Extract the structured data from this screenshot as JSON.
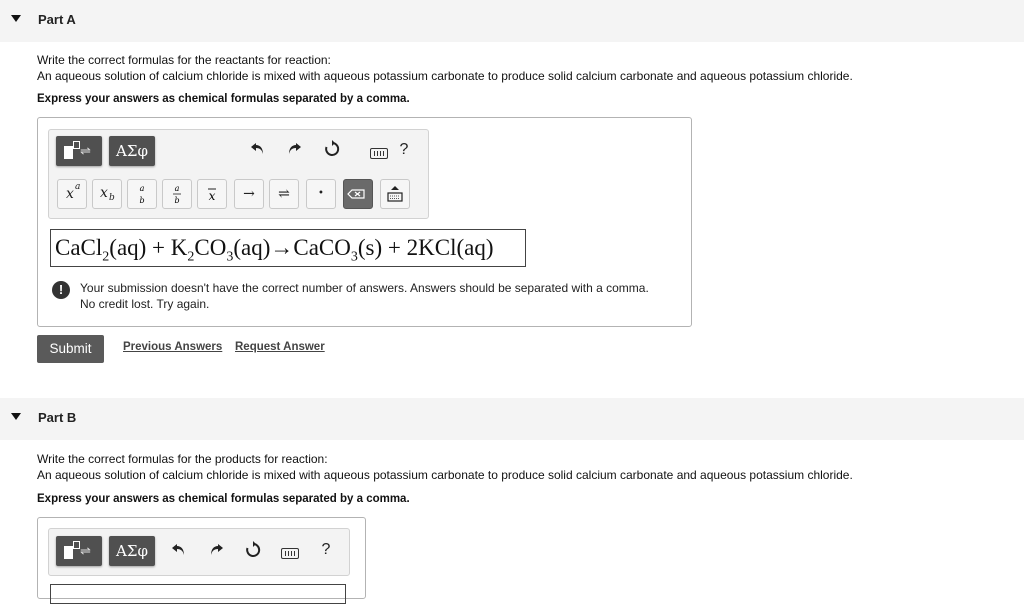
{
  "part_a": {
    "title": "Part A",
    "prompt_line1": "Write the correct formulas for the reactants for reaction:",
    "prompt_line2": "An aqueous solution of calcium chloride is mixed with aqueous potassium carbonate to produce solid calcium carbonate and aqueous potassium chloride.",
    "instruction": "Express your answers as chemical formulas separated by a comma.",
    "toolbar": {
      "greek_label": "ΑΣφ",
      "help_label": "?"
    },
    "keyboard": {
      "superscript": "x",
      "superscript_sup": "a",
      "subscript": "x",
      "subscript_sub": "b",
      "arrow": "→",
      "equilibrium": "⇌",
      "dot": "•"
    },
    "answer": {
      "t1": "CaCl",
      "s1": "2",
      "t2": "(aq) + K",
      "s2": "2",
      "t3": "CO",
      "s3": "3",
      "t4": "(aq)→CaCO",
      "s4": "3",
      "t5": "(s) + 2KCl(aq)"
    },
    "feedback_line1": "Your submission doesn't have the correct number of answers. Answers should be separated with a comma.",
    "feedback_line2": "No credit lost. Try again.",
    "submit_label": "Submit",
    "previous_answers_label": "Previous Answers",
    "request_answer_label": "Request Answer"
  },
  "part_b": {
    "title": "Part B",
    "prompt_line1": "Write the correct formulas for the products for reaction:",
    "prompt_line2": "An aqueous solution of calcium chloride is mixed with aqueous potassium carbonate to produce solid calcium carbonate and aqueous potassium chloride.",
    "instruction": "Express your answers as chemical formulas separated by a comma.",
    "toolbar": {
      "greek_label": "ΑΣφ",
      "help_label": "?"
    }
  }
}
